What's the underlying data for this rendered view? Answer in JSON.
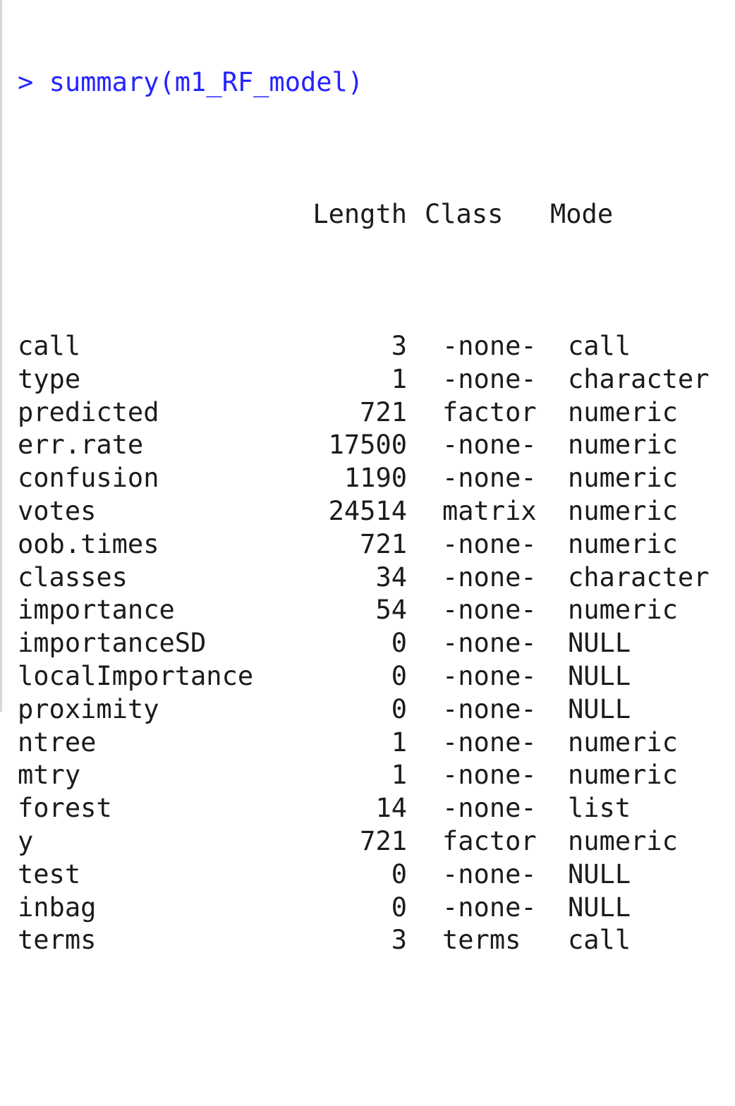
{
  "console": {
    "prompt_symbol": ">",
    "command": "summary(m1_RF_model)",
    "columns": {
      "length": "Length",
      "class": "Class",
      "mode": "Mode"
    },
    "rows": [
      {
        "name": "call",
        "length": "3",
        "class": "-none-",
        "mode": "call"
      },
      {
        "name": "type",
        "length": "1",
        "class": "-none-",
        "mode": "character"
      },
      {
        "name": "predicted",
        "length": "721",
        "class": "factor",
        "mode": "numeric"
      },
      {
        "name": "err.rate",
        "length": "17500",
        "class": "-none-",
        "mode": "numeric"
      },
      {
        "name": "confusion",
        "length": "1190",
        "class": "-none-",
        "mode": "numeric"
      },
      {
        "name": "votes",
        "length": "24514",
        "class": "matrix",
        "mode": "numeric"
      },
      {
        "name": "oob.times",
        "length": "721",
        "class": "-none-",
        "mode": "numeric"
      },
      {
        "name": "classes",
        "length": "34",
        "class": "-none-",
        "mode": "character"
      },
      {
        "name": "importance",
        "length": "54",
        "class": "-none-",
        "mode": "numeric"
      },
      {
        "name": "importanceSD",
        "length": "0",
        "class": "-none-",
        "mode": "NULL"
      },
      {
        "name": "localImportance",
        "length": "0",
        "class": "-none-",
        "mode": "NULL"
      },
      {
        "name": "proximity",
        "length": "0",
        "class": "-none-",
        "mode": "NULL"
      },
      {
        "name": "ntree",
        "length": "1",
        "class": "-none-",
        "mode": "numeric"
      },
      {
        "name": "mtry",
        "length": "1",
        "class": "-none-",
        "mode": "numeric"
      },
      {
        "name": "forest",
        "length": "14",
        "class": "-none-",
        "mode": "list"
      },
      {
        "name": "y",
        "length": "721",
        "class": "factor",
        "mode": "numeric"
      },
      {
        "name": "test",
        "length": "0",
        "class": "-none-",
        "mode": "NULL"
      },
      {
        "name": "inbag",
        "length": "0",
        "class": "-none-",
        "mode": "NULL"
      },
      {
        "name": "terms",
        "length": "3",
        "class": "terms",
        "mode": "call"
      }
    ],
    "final_prompt": ">"
  },
  "colors": {
    "command_blue": "#2424ff",
    "output_text": "#1b1b1b",
    "background": "#ffffff"
  }
}
